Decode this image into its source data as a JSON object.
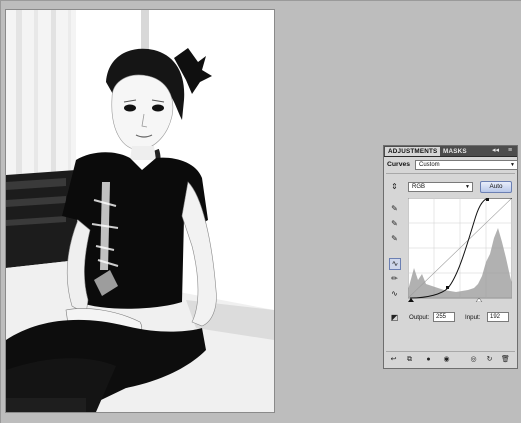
{
  "panel": {
    "tabs": [
      {
        "label": "ADJUSTMENTS"
      },
      {
        "label": "MASKS"
      }
    ],
    "tab_controls": {
      "collapse": "◂◂",
      "menu": "≡"
    },
    "adjustment_label": "Curves",
    "preset_value": "Custom",
    "channel_value": "RGB",
    "auto_label": "Auto",
    "output_label": "Output:",
    "output_value": "255",
    "input_label": "Input:",
    "input_value": "192",
    "tools": [
      {
        "name": "on-image-adjust-icon",
        "glyph": "⇕"
      },
      {
        "name": "black-point-eyedropper-icon",
        "glyph": "✎"
      },
      {
        "name": "gray-point-eyedropper-icon",
        "glyph": "✎"
      },
      {
        "name": "white-point-eyedropper-icon",
        "glyph": "✎"
      },
      {
        "name": "curve-edit-points-icon",
        "glyph": "∿"
      },
      {
        "name": "pencil-draw-icon",
        "glyph": "✏"
      },
      {
        "name": "smooth-curve-icon",
        "glyph": "∿"
      },
      {
        "name": "show-clipping-icon",
        "glyph": "◩"
      }
    ],
    "bottom_icons": [
      {
        "name": "return-to-list-icon",
        "glyph": "↩"
      },
      {
        "name": "expanded-view-icon",
        "glyph": "⧉"
      },
      {
        "name": "clip-to-layer-icon",
        "glyph": "●"
      },
      {
        "name": "visibility-eye-icon",
        "glyph": "◉"
      },
      {
        "name": "view-previous-state-icon",
        "glyph": "◎"
      },
      {
        "name": "reset-icon",
        "glyph": "↻"
      },
      {
        "name": "delete-layer-icon",
        "glyph": "🗑"
      }
    ]
  },
  "colors": {
    "workspace_bg": "#bdbdbd",
    "panel_bg": "#d6d6d6",
    "panel_tabbar": "#4d4d4d",
    "highlight": "#6b7fb3"
  }
}
